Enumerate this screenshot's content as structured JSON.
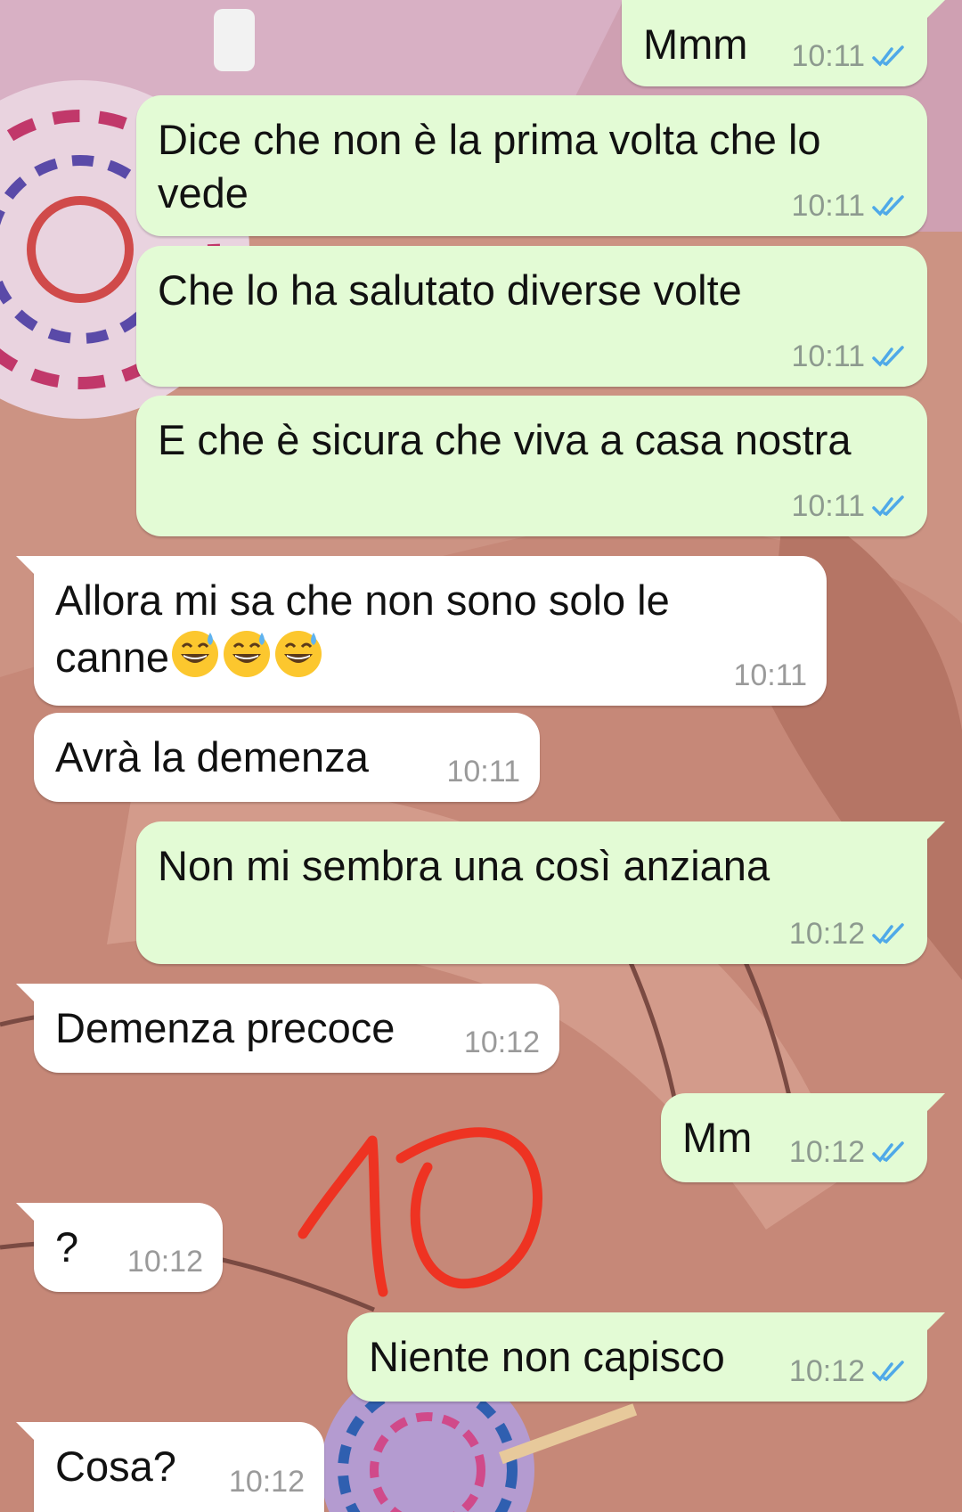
{
  "chat": {
    "messages": [
      {
        "direction": "out",
        "text": "Mmm",
        "time": "10:11",
        "status": "read"
      },
      {
        "direction": "out",
        "text": "Dice che non è la prima volta che lo vede",
        "time": "10:11",
        "status": "read"
      },
      {
        "direction": "out",
        "text": "Che lo ha salutato diverse volte",
        "time": "10:11",
        "status": "read"
      },
      {
        "direction": "out",
        "text": "E che è sicura che viva a casa nostra",
        "time": "10:11",
        "status": "read"
      },
      {
        "direction": "in",
        "text": "Allora mi sa che non sono solo le canne",
        "emoji": [
          "grinning-face-with-sweat",
          "grinning-face-with-sweat",
          "grinning-face-with-sweat"
        ],
        "time": "10:11"
      },
      {
        "direction": "in",
        "text": "Avrà la demenza",
        "time": "10:11"
      },
      {
        "direction": "out",
        "text": "Non mi sembra una così anziana",
        "time": "10:12",
        "status": "read"
      },
      {
        "direction": "in",
        "text": "Demenza precoce",
        "time": "10:12"
      },
      {
        "direction": "out",
        "text": "Mm",
        "time": "10:12",
        "status": "read"
      },
      {
        "direction": "in",
        "text": "?",
        "time": "10:12"
      },
      {
        "direction": "out",
        "text": "Niente non capisco",
        "time": "10:12",
        "status": "read"
      },
      {
        "direction": "in",
        "text": "Cosa?",
        "time": "10:12"
      }
    ]
  },
  "annotation": {
    "handwritten_mark": "10",
    "color": "#ee3322"
  },
  "colors": {
    "outgoing_bubble": "#e3fbd5",
    "incoming_bubble": "#ffffff",
    "read_ticks": "#4fa9e8",
    "timestamp": "#8d9a8f"
  }
}
